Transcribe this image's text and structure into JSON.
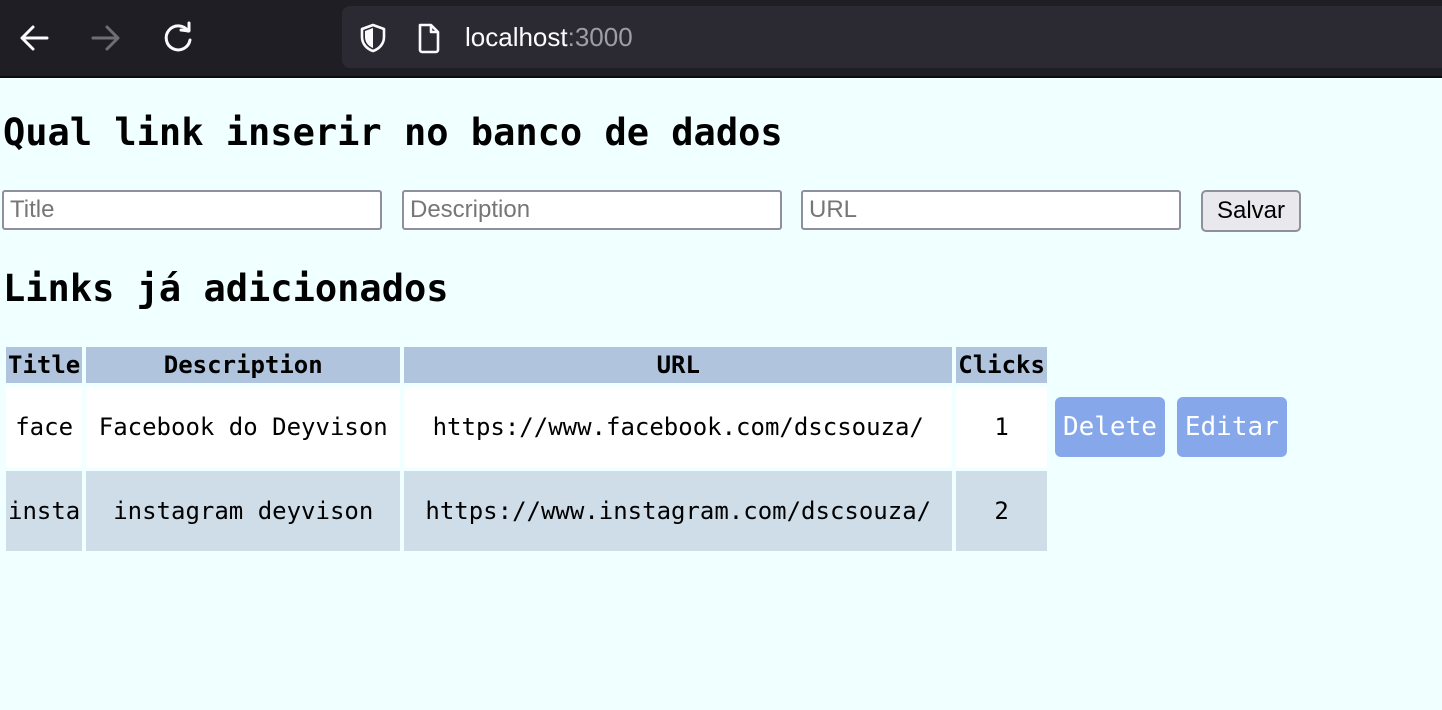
{
  "browser": {
    "url_host": "localhost",
    "url_port": ":3000",
    "icons": [
      "back-arrow-icon",
      "forward-arrow-icon",
      "reload-icon",
      "shield-icon",
      "page-icon"
    ]
  },
  "form": {
    "heading": "Qual link inserir no banco de dados",
    "title_placeholder": "Title",
    "description_placeholder": "Description",
    "url_placeholder": "URL",
    "save_label": "Salvar"
  },
  "list": {
    "heading": "Links já adicionados",
    "columns": [
      "Title",
      "Description",
      "URL",
      "Clicks"
    ],
    "rows": [
      {
        "title": "face",
        "description": "Facebook do Deyvison",
        "url": "https://www.facebook.com/dscsouza/",
        "clicks": "1"
      },
      {
        "title": "insta",
        "description": "instagram deyvison",
        "url": "https://www.instagram.com/dscsouza/",
        "clicks": "2"
      }
    ],
    "delete_label": "Delete",
    "edit_label": "Editar"
  },
  "colors": {
    "page_bg": "#f0ffff",
    "header_bg": "#b0c4de",
    "row_alt_bg": "#cfdde8",
    "action_button_bg": "#86a8eb"
  }
}
